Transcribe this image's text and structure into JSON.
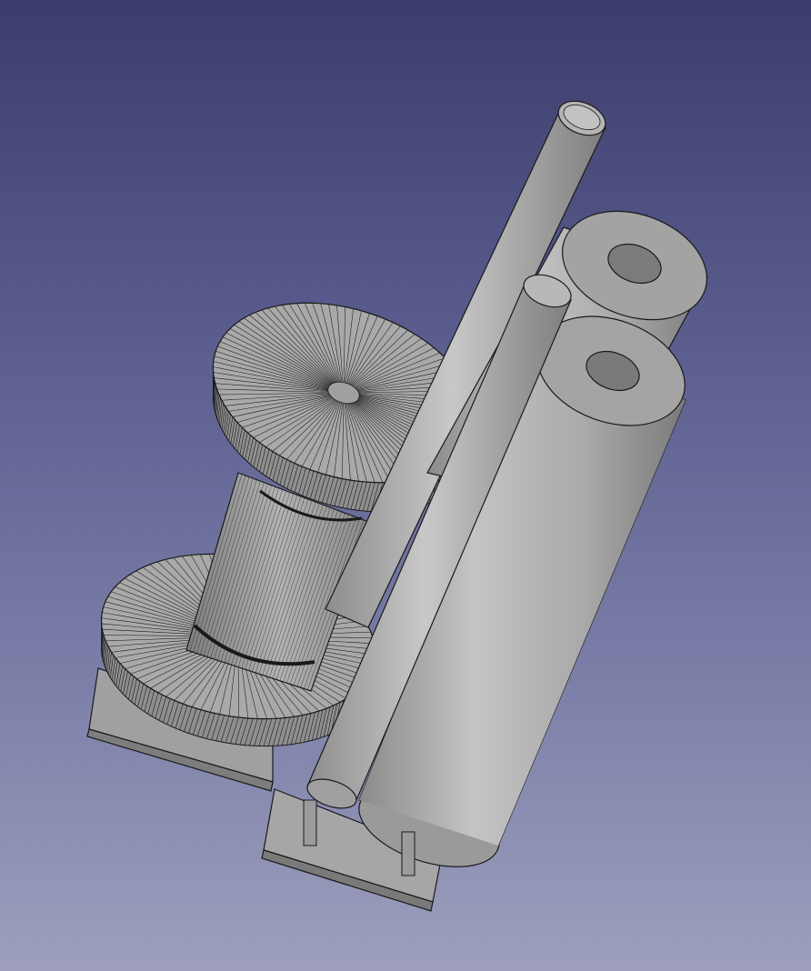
{
  "viewport": {
    "background_top": "#3c3d6c",
    "background_bottom": "#9d9fbd"
  },
  "model": {
    "parts": [
      {
        "name": "base-plate-left",
        "shape": "flat-plate"
      },
      {
        "name": "base-plate-right",
        "shape": "flat-plate"
      },
      {
        "name": "spool-lower-flange",
        "shape": "disc",
        "render": "mesh-wireframe"
      },
      {
        "name": "spool-core",
        "shape": "cylinder",
        "render": "mesh-wireframe"
      },
      {
        "name": "spool-upper-flange",
        "shape": "disc",
        "render": "mesh-wireframe"
      },
      {
        "name": "rod-back",
        "shape": "thin-cylinder",
        "render": "shaded"
      },
      {
        "name": "tube-back",
        "shape": "hollow-cylinder",
        "render": "shaded"
      },
      {
        "name": "tube-front",
        "shape": "hollow-cylinder",
        "render": "shaded"
      },
      {
        "name": "rod-front",
        "shape": "thin-cylinder",
        "render": "shaded"
      }
    ],
    "face_color": "#a9a9a9",
    "edge_color": "#1a1a1a"
  }
}
